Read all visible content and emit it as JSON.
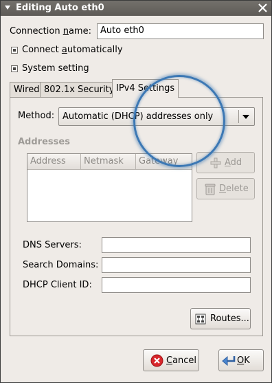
{
  "window": {
    "title": "Editing Auto eth0"
  },
  "connection_name": {
    "label_pre": "Connection ",
    "label_u": "n",
    "label_post": "ame:",
    "value": "Auto eth0"
  },
  "connect_automatically": {
    "pre": "Connect ",
    "u": "a",
    "post": "utomatically",
    "checked": true
  },
  "system_setting": {
    "label": "System setting",
    "checked": true
  },
  "tabs": [
    {
      "label": "Wired",
      "active": false
    },
    {
      "label": "802.1x Security",
      "active": false
    },
    {
      "label": "IPv4 Settings",
      "active": true
    }
  ],
  "ipv4": {
    "method_label": "Method:",
    "method_value": "Automatic (DHCP) addresses only",
    "addresses_heading": "Addresses",
    "columns": [
      "Address",
      "Netmask",
      "Gateway"
    ],
    "add_button": {
      "u": "A",
      "post": "dd"
    },
    "delete_button": {
      "u": "D",
      "post": "elete"
    },
    "dns_servers_label": "DNS Servers:",
    "dns_servers_value": "",
    "search_domains_label": "Search Domains:",
    "search_domains_value": "",
    "dhcp_client_id_label": "DHCP Client ID:",
    "dhcp_client_id_value": "",
    "routes_button": "Routes..."
  },
  "footer": {
    "cancel": {
      "u": "C",
      "post": "ancel"
    },
    "ok": {
      "u": "O",
      "post": "K"
    }
  },
  "colors": {
    "focus_ring": "#3c78b4",
    "title_bar": "#5e5b57",
    "window_bg": "#efebe7"
  }
}
